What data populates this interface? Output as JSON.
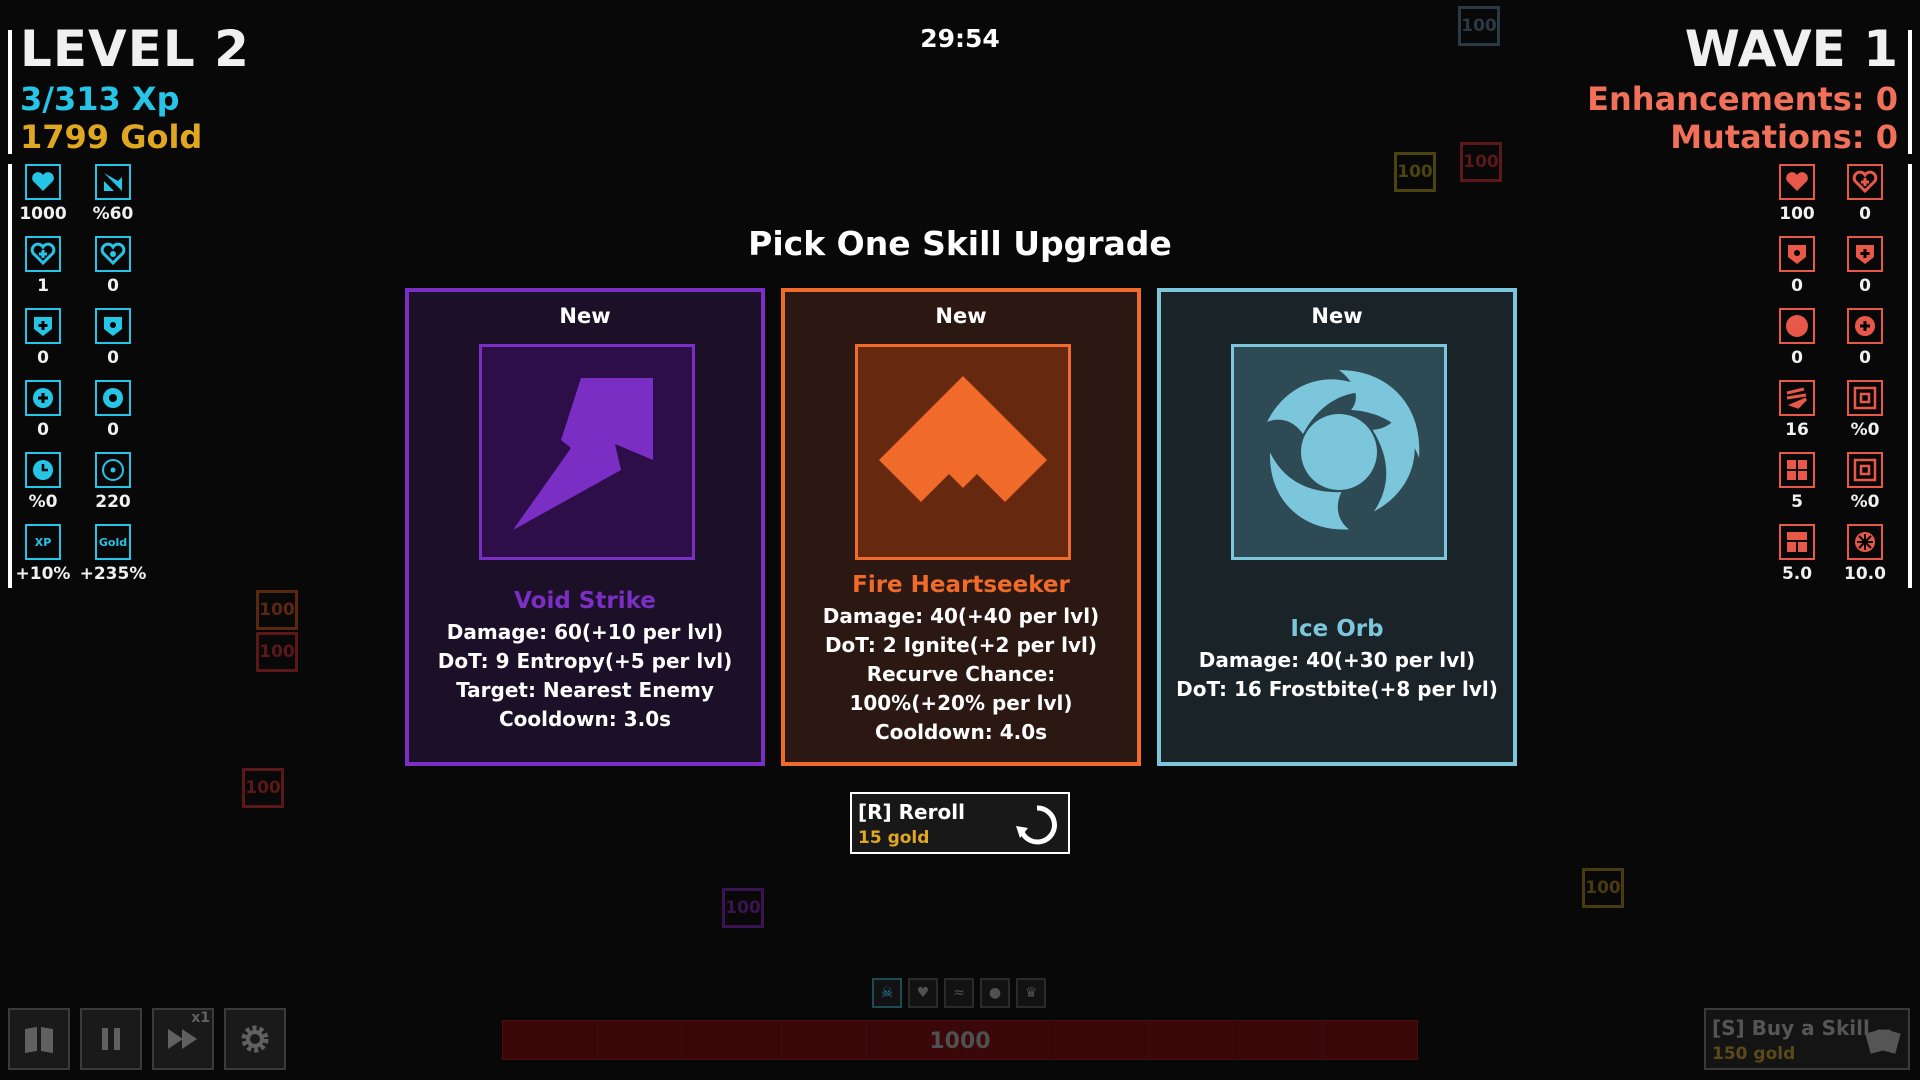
{
  "hud": {
    "level": "LEVEL 2",
    "xp": "3/313 Xp",
    "gold": "1799 Gold",
    "timer": "29:54",
    "wave": "WAVE 1",
    "enhancements": "Enhancements: 0",
    "mutations": "Mutations: 0"
  },
  "player_stats": [
    {
      "icon": "heart-icon",
      "value": "1000"
    },
    {
      "icon": "speed-arrow-icon",
      "value": "%60"
    },
    {
      "icon": "heart-plus-icon",
      "value": "1"
    },
    {
      "icon": "heart-shield-icon",
      "value": "0"
    },
    {
      "icon": "shield-plus-icon",
      "value": "0"
    },
    {
      "icon": "shield-icon",
      "value": "0"
    },
    {
      "icon": "circle-plus-icon",
      "value": "0"
    },
    {
      "icon": "ring-icon",
      "value": "0"
    },
    {
      "icon": "clock-icon",
      "value": "%0"
    },
    {
      "icon": "target-icon",
      "value": "220"
    },
    {
      "icon": "xp-icon",
      "icon_text": "XP",
      "value": "+10%"
    },
    {
      "icon": "gold-icon",
      "icon_text": "Gold",
      "value": "+235%"
    }
  ],
  "enemy_stats": [
    {
      "icon": "heart-icon",
      "value": "100"
    },
    {
      "icon": "heart-plus-icon",
      "value": "0"
    },
    {
      "icon": "shield-icon",
      "value": "0"
    },
    {
      "icon": "shield-plus-icon",
      "value": "0"
    },
    {
      "icon": "circle-icon",
      "value": "0"
    },
    {
      "icon": "circle-plus-icon",
      "value": "0"
    },
    {
      "icon": "speed-icon",
      "value": "16"
    },
    {
      "icon": "square-target-icon",
      "value": "%0"
    },
    {
      "icon": "grid-icon",
      "value": "5"
    },
    {
      "icon": "square-target-icon",
      "value": "%0"
    },
    {
      "icon": "grid-split-icon",
      "value": "5.0"
    },
    {
      "icon": "spiky-orb-icon",
      "value": "10.0"
    }
  ],
  "background_markers": [
    {
      "text": "100",
      "color": "#2a3a44"
    },
    {
      "text": "100",
      "color": "#5a1818"
    },
    {
      "text": "100",
      "color": "#4a4410"
    },
    {
      "text": "100",
      "color": "#5a2810"
    },
    {
      "text": "100",
      "color": "#5a1818"
    },
    {
      "text": "100",
      "color": "#5a1818"
    },
    {
      "text": "100",
      "color": "#3a1450"
    },
    {
      "text": "100",
      "color": "#4a3a10"
    }
  ],
  "modal": {
    "title": "Pick One Skill Upgrade",
    "cards": [
      {
        "tag": "New",
        "name": "Void Strike",
        "lines": [
          "Damage: 60(+10 per lvl)",
          "DoT: 9 Entropy(+5 per lvl)",
          "Target: Nearest Enemy",
          "Cooldown: 3.0s"
        ],
        "icon": "void-strike-icon",
        "border": "#7a2ec4",
        "bg": "#1c1028",
        "art_bg": "#2e0e48",
        "accent": "#7a2ec4"
      },
      {
        "tag": "New",
        "name": "Fire Heartseeker",
        "lines": [
          "Damage: 40(+40 per lvl)",
          "DoT: 2 Ignite(+2 per lvl)",
          "Recurve Chance:",
          "100%(+20% per lvl)",
          "Cooldown: 4.0s"
        ],
        "icon": "fire-heartseeker-icon",
        "border": "#f06a2a",
        "bg": "#2c1812",
        "art_bg": "#66280e",
        "accent": "#f06a2a"
      },
      {
        "tag": "New",
        "name": "Ice Orb",
        "lines": [
          "Damage: 40(+30 per lvl)",
          "DoT: 16 Frostbite(+8 per lvl)"
        ],
        "icon": "ice-orb-icon",
        "border": "#7cc6dc",
        "bg": "#1a2428",
        "art_bg": "#2e4a54",
        "accent": "#7cc6dc"
      }
    ],
    "reroll": {
      "label": "[R] Reroll",
      "cost": "15 gold"
    }
  },
  "bottom": {
    "speed_multiplier": "x1",
    "base_hp": "1000",
    "buy_skill": {
      "label": "[S] Buy a Skill",
      "cost": "150 gold"
    }
  }
}
